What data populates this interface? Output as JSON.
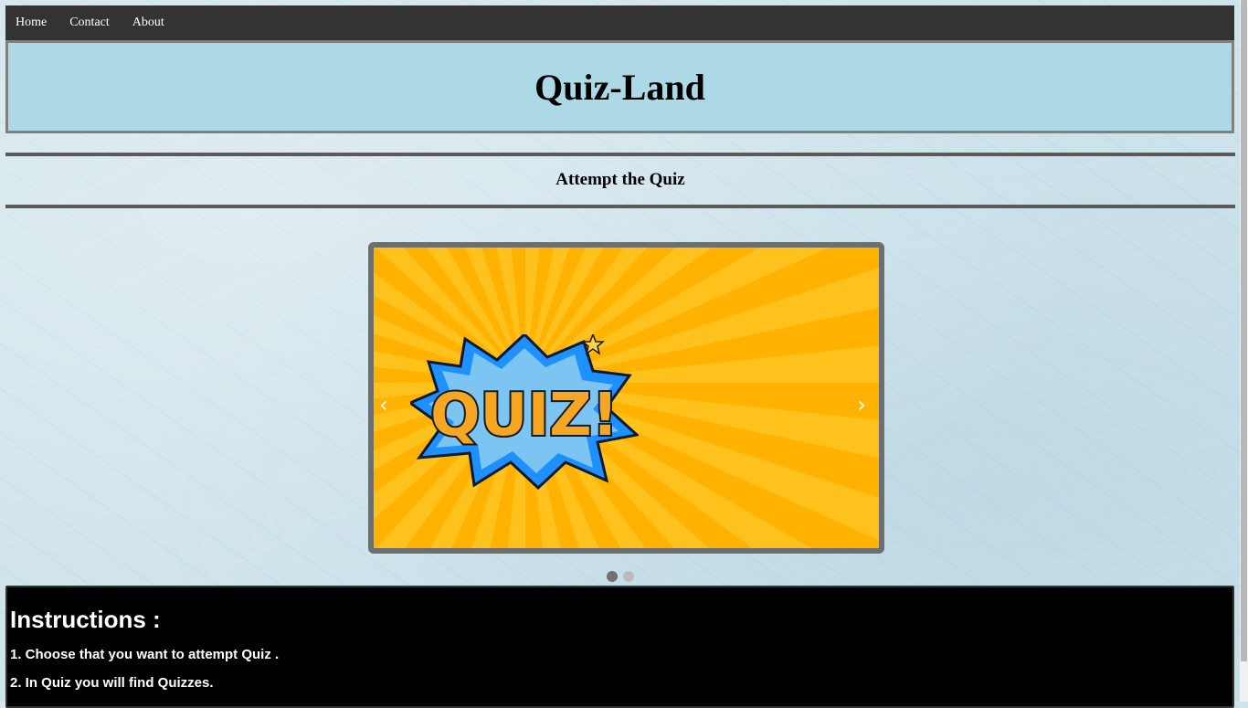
{
  "nav": {
    "items": [
      {
        "label": "Home"
      },
      {
        "label": "Contact"
      },
      {
        "label": "About"
      }
    ]
  },
  "header": {
    "title": "Quiz-Land"
  },
  "section": {
    "heading": "Attempt the Quiz"
  },
  "carousel": {
    "slide_text": "QUIZ!",
    "prev_icon": "‹",
    "next_icon": "›",
    "slide_count": 2,
    "active_index": 0,
    "colors": {
      "background": "#ffb200",
      "burst": "#1e90ff",
      "text": "#f5a623"
    }
  },
  "instructions": {
    "title": "Instructions :",
    "lines": [
      "1. Choose that you want to attempt Quiz .",
      "2. In Quiz you will find Quizzes."
    ]
  },
  "colors": {
    "navbar": "#333333",
    "header_bg": "#add8e6",
    "instructions_bg": "#000000"
  }
}
